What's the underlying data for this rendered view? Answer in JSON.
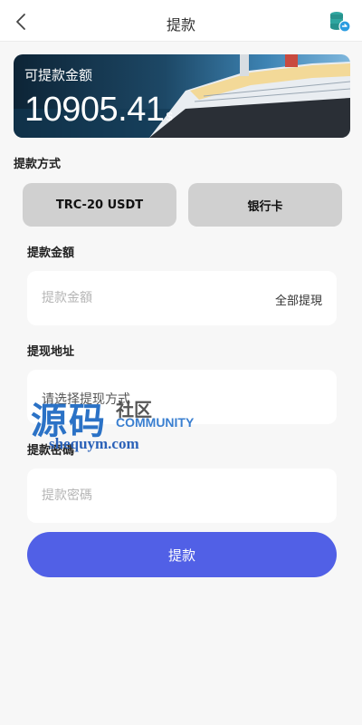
{
  "header": {
    "title": "提款",
    "back_icon": "chevron-left-icon",
    "coin_icon": "coin-stack-icon"
  },
  "balance": {
    "label": "可提款金额",
    "amount": "10905.41",
    "currency": "$"
  },
  "method": {
    "title": "提款方式",
    "options": [
      "TRC-20 USDT",
      "银行卡"
    ]
  },
  "amount_field": {
    "title": "提款金額",
    "placeholder": "提款金額",
    "all_label": "全部提現"
  },
  "address_field": {
    "title": "提现地址",
    "value": "请选择提现方式"
  },
  "password_field": {
    "title": "提款密碼",
    "placeholder": "提款密碼"
  },
  "submit_label": "提款",
  "watermark": {
    "big": "源码",
    "cn": "社区",
    "en": "COMMUNITY",
    "url": "shequym.com"
  },
  "colors": {
    "accent": "#5160e6",
    "method_button": "#d0d0d0",
    "background": "#f7f7f7"
  }
}
